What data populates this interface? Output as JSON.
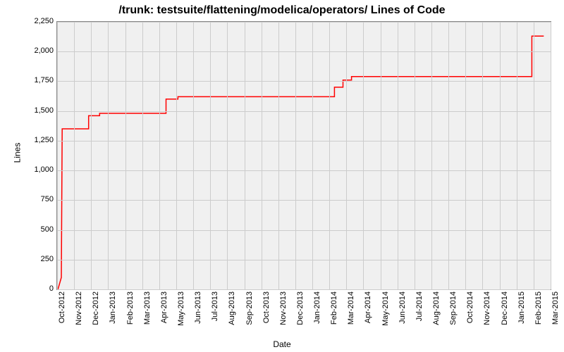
{
  "chart_data": {
    "type": "line",
    "title": "/trunk: testsuite/flattening/modelica/operators/ Lines of Code",
    "xlabel": "Date",
    "ylabel": "Lines",
    "ylim": [
      0,
      2250
    ],
    "ytick_step": 250,
    "categories": [
      "Oct-2012",
      "Nov-2012",
      "Dec-2012",
      "Jan-2013",
      "Feb-2013",
      "Mar-2013",
      "Apr-2013",
      "May-2013",
      "Jun-2013",
      "Jul-2013",
      "Aug-2013",
      "Sep-2013",
      "Oct-2013",
      "Nov-2013",
      "Dec-2013",
      "Jan-2014",
      "Feb-2014",
      "Mar-2014",
      "Apr-2014",
      "May-2014",
      "Jun-2014",
      "Jul-2014",
      "Aug-2014",
      "Sep-2014",
      "Oct-2014",
      "Nov-2014",
      "Dec-2014",
      "Jan-2015",
      "Feb-2015",
      "Mar-2015"
    ],
    "series": [
      {
        "name": "Lines of Code",
        "color": "#ff0000",
        "points": [
          {
            "x": "Oct-2012",
            "frac": 0.05,
            "y": 0
          },
          {
            "x": "Oct-2012",
            "frac": 0.25,
            "y": 100
          },
          {
            "x": "Oct-2012",
            "frac": 0.3,
            "y": 1350
          },
          {
            "x": "Nov-2012",
            "frac": 0.85,
            "y": 1350
          },
          {
            "x": "Nov-2012",
            "frac": 0.85,
            "y": 1460
          },
          {
            "x": "Dec-2012",
            "frac": 0.5,
            "y": 1460
          },
          {
            "x": "Dec-2012",
            "frac": 0.5,
            "y": 1480
          },
          {
            "x": "Apr-2013",
            "frac": 0.4,
            "y": 1480
          },
          {
            "x": "Apr-2013",
            "frac": 0.4,
            "y": 1600
          },
          {
            "x": "May-2013",
            "frac": 0.1,
            "y": 1600
          },
          {
            "x": "May-2013",
            "frac": 0.1,
            "y": 1620
          },
          {
            "x": "Feb-2014",
            "frac": 0.3,
            "y": 1620
          },
          {
            "x": "Feb-2014",
            "frac": 0.3,
            "y": 1700
          },
          {
            "x": "Feb-2014",
            "frac": 0.8,
            "y": 1700
          },
          {
            "x": "Feb-2014",
            "frac": 0.8,
            "y": 1760
          },
          {
            "x": "Mar-2014",
            "frac": 0.3,
            "y": 1760
          },
          {
            "x": "Mar-2014",
            "frac": 0.3,
            "y": 1790
          },
          {
            "x": "Jan-2015",
            "frac": 0.9,
            "y": 1790
          },
          {
            "x": "Jan-2015",
            "frac": 0.9,
            "y": 2130
          },
          {
            "x": "Feb-2015",
            "frac": 0.6,
            "y": 2130
          }
        ]
      }
    ]
  }
}
